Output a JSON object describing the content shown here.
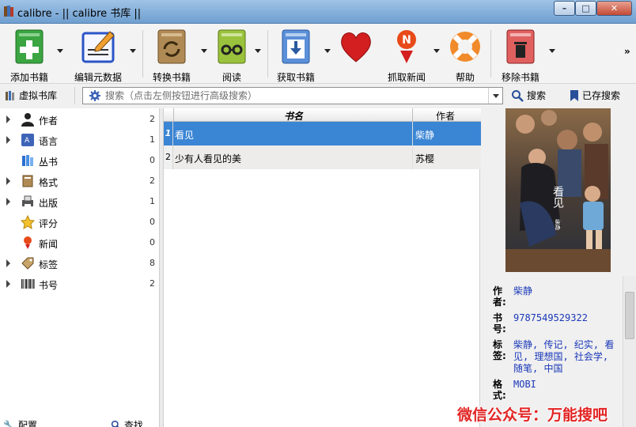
{
  "window": {
    "title": "calibre - || calibre 书库 ||",
    "controls": [
      "–",
      "□",
      "✕"
    ]
  },
  "toolbar": {
    "add": "添加书籍",
    "edit": "编辑元数据",
    "convert": "转换书籍",
    "read": "阅读",
    "get": "获取书籍",
    "news": "抓取新闻",
    "help": "帮助",
    "remove": "移除书籍",
    "more": "»"
  },
  "searchbar": {
    "virtual_library": "虚拟书库",
    "placeholder": "搜索（点击左侧按钮进行高级搜索）",
    "search_btn": "搜索",
    "saved_btn": "已存搜索"
  },
  "tag_browser": {
    "items": [
      {
        "name": "作者",
        "count": "2",
        "expandable": true,
        "icon": "user-icon"
      },
      {
        "name": "语言",
        "count": "1",
        "expandable": true,
        "icon": "language-icon"
      },
      {
        "name": "丛书",
        "count": "0",
        "expandable": false,
        "icon": "series-icon"
      },
      {
        "name": "格式",
        "count": "2",
        "expandable": true,
        "icon": "format-icon"
      },
      {
        "name": "出版",
        "count": "1",
        "expandable": true,
        "icon": "publisher-icon"
      },
      {
        "name": "评分",
        "count": "0",
        "expandable": false,
        "icon": "star-icon"
      },
      {
        "name": "新闻",
        "count": "0",
        "expandable": false,
        "icon": "news-icon"
      },
      {
        "name": "标签",
        "count": "8",
        "expandable": true,
        "icon": "tag-icon"
      },
      {
        "name": "书号",
        "count": "2",
        "expandable": true,
        "icon": "barcode-icon"
      }
    ],
    "bottom_config": "配置",
    "bottom_find": "查找"
  },
  "book_list": {
    "headers": {
      "title": "书名",
      "author": "作者"
    },
    "rows": [
      {
        "num": "1",
        "title": "看见",
        "author": "柴静",
        "selected": true
      },
      {
        "num": "2",
        "title": "少有人看见的美",
        "author": "苏樱",
        "selected": false
      }
    ]
  },
  "details": {
    "author_label": "作\n者:",
    "author": "柴静",
    "isbn_label": "书\n号:",
    "isbn": "9787549529322",
    "tags_label": "标\n签:",
    "tags": "柴静, 传记, 纪实, 看见, 理想国, 社会学, 随笔, 中国",
    "formats_label": "格\n式:",
    "formats": "MOBI",
    "cover_text": {
      "title": "看见",
      "author": "柴静"
    }
  },
  "watermark": "微信公众号：万能搜吧",
  "colors": {
    "selection": "#3a85d4",
    "link": "#1a38b8",
    "watermark": "#e22424"
  }
}
